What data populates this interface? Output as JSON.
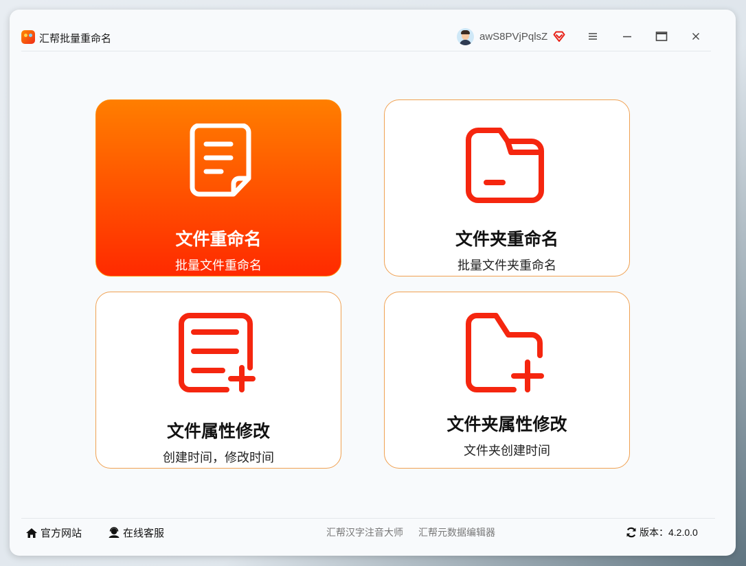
{
  "window": {
    "title": "汇帮批量重命名",
    "username": "awS8PVjPqlsZ"
  },
  "colors": {
    "accent_start": "#ff7e00",
    "accent_end": "#ff2a00",
    "icon_red": "#f5260f",
    "card_border": "#f0a050"
  },
  "cards": [
    {
      "title": "文件重命名",
      "subtitle": "批量文件重命名",
      "icon": "document-icon",
      "active": true
    },
    {
      "title": "文件夹重命名",
      "subtitle": "批量文件夹重命名",
      "icon": "folder-icon",
      "active": false
    },
    {
      "title": "文件属性修改",
      "subtitle": "创建时间，修改时间",
      "icon": "document-add-icon",
      "active": false
    },
    {
      "title": "文件夹属性修改",
      "subtitle": "文件夹创建时间",
      "icon": "folder-add-icon",
      "active": false
    }
  ],
  "footer": {
    "website": "官方网站",
    "support": "在线客服",
    "tool1": "汇帮汉字注音大师",
    "tool2": "汇帮元数据编辑器",
    "version_label": "版本：",
    "version_value": "4.2.0.0"
  }
}
